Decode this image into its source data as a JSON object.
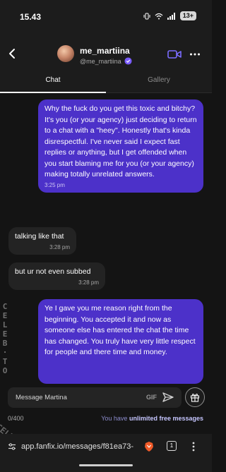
{
  "status_bar": {
    "time": "15.43",
    "battery": "13+",
    "icons": [
      "notification-icon",
      "vibrate-icon",
      "wifi-icon",
      "signal-icon",
      "battery-icon"
    ]
  },
  "header": {
    "name": "me_martiina",
    "handle": "@me_martiina",
    "icons": [
      "back-icon",
      "verified-icon",
      "video-call-icon",
      "more-icon"
    ]
  },
  "tabs": [
    {
      "label": "Chat",
      "active": true
    },
    {
      "label": "Gallery",
      "active": false
    }
  ],
  "messages": [
    {
      "direction": "sent",
      "text": "Why the fuck do you get this toxic and bitchy? It's you (or your agency) just deciding to return to a chat with a \"heey\". Honestly that's kinda disrespectful. I've never said I expect fast replies or anything, but I get offended when you start blaming me for you (or your agency) making totally unrelated answers.",
      "time": "3:25 pm"
    },
    {
      "direction": "received",
      "text": "talking like that",
      "time": "3:28 pm"
    },
    {
      "direction": "received",
      "text": "but ur not even subbed",
      "time": "3:28 pm"
    },
    {
      "direction": "sent",
      "text": "Ye I gave you me reason right from the beginning. You accepted it and now as someone else has entered the chat the time has changed. You truly have very little respect for people and there time and money.",
      "time": ""
    }
  ],
  "composer": {
    "placeholder": "Message Martina",
    "gif_label": "GIF",
    "counter": "0/400",
    "free_prefix": "You have ",
    "free_emphasis": "unlimited free messages"
  },
  "browser": {
    "url": "app.fanfix.io/messages/f81ea73-",
    "tab_count": "1"
  },
  "watermark": {
    "left": "CELEB.TO",
    "bottom": "CELEB.TO"
  },
  "colors": {
    "sent_bubble": "#4c31c9",
    "received_bubble": "#232323",
    "background": "#141414",
    "accent_link": "#c6c6ff"
  }
}
